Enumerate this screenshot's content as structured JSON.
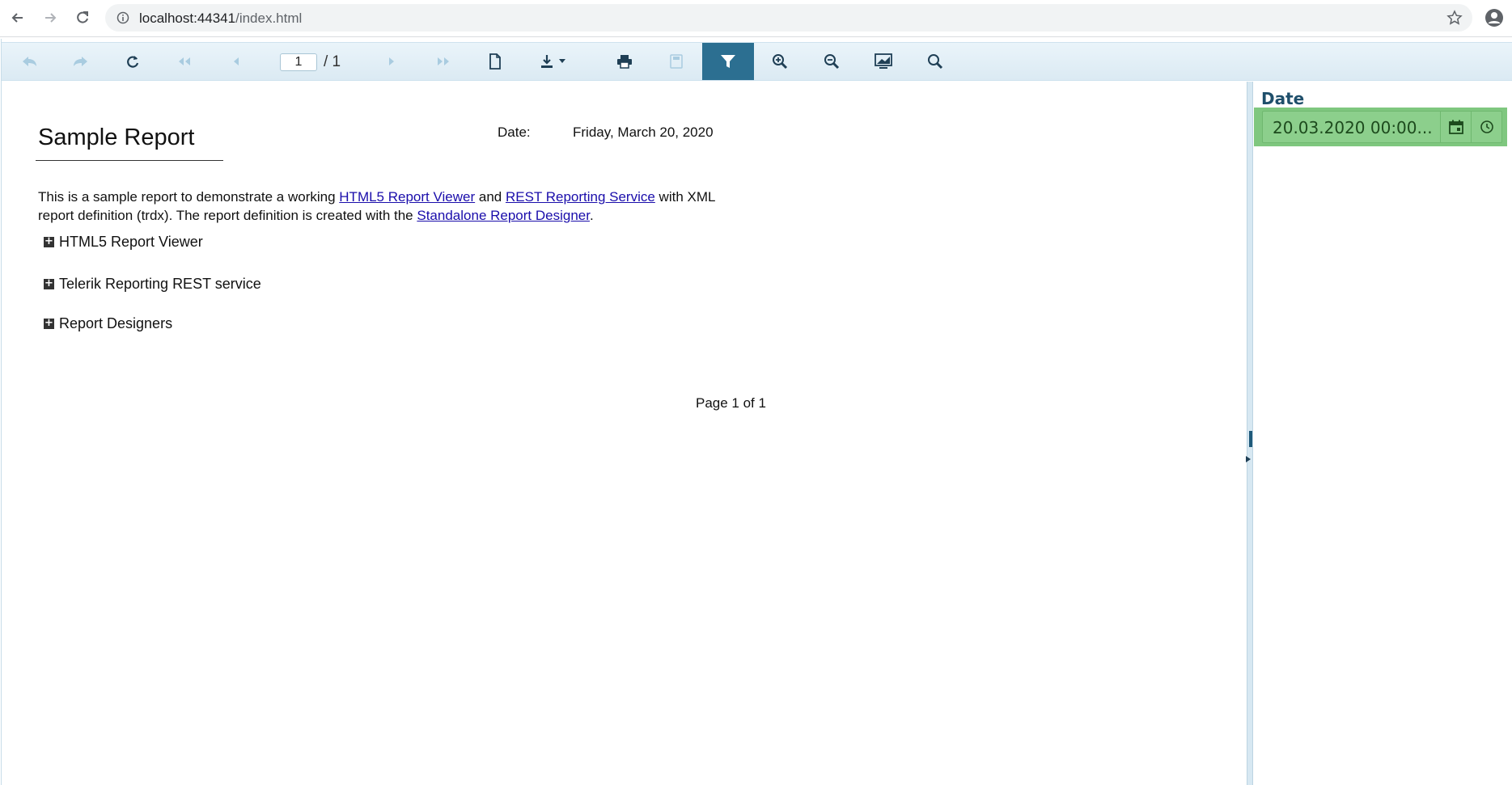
{
  "browser": {
    "url_host": "localhost:44341",
    "url_path": "/index.html"
  },
  "toolbar": {
    "current_page": "1",
    "total_pages": "/ 1"
  },
  "report": {
    "title": "Sample Report",
    "date_label": "Date:",
    "date_value": "Friday, March 20, 2020",
    "intro_1": "This is a sample report to demonstrate a working ",
    "link_html5": "HTML5 Report Viewer",
    "intro_2": " and ",
    "link_rest": "REST Reporting Service",
    "intro_3": " with XML report definition (trdx). The report definition is created with the ",
    "link_designer": "Standalone Report Designer",
    "intro_4": ".",
    "sections": [
      "HTML5 Report Viewer",
      "Telerik Reporting REST service",
      "Report Designers"
    ],
    "footer": "Page 1 of 1"
  },
  "parameters": {
    "label": "Date",
    "value": "20.03.2020 00:00..."
  },
  "colors": {
    "toolbar_active": "#2c6f91",
    "param_highlight": "#8ccf8c",
    "link": "#1a0dab"
  }
}
